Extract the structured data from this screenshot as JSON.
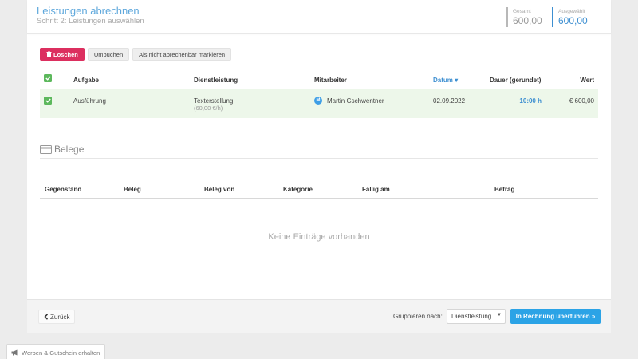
{
  "header": {
    "title": "Leistungen abrechnen",
    "subtitle": "Schritt 2: Leistungen auswählen",
    "total_label": "Gesamt",
    "total_value": "600,00",
    "selected_label": "Ausgewählt",
    "selected_value": "600,00"
  },
  "toolbar": {
    "delete_label": "Löschen",
    "rebook_label": "Umbuchen",
    "mark_label": "Als nicht abrechenbar markieren"
  },
  "services_table": {
    "columns": {
      "task": "Aufgabe",
      "service": "Dienstleistung",
      "employee": "Mitarbeiter",
      "date": "Datum",
      "duration": "Dauer (gerundet)",
      "value": "Wert"
    },
    "rows": [
      {
        "task": "Ausführung",
        "service": "Texterstellung",
        "rate": "(60,00 €/h)",
        "employee_initial": "M",
        "employee": "Martin Gschwentner",
        "date": "02.09.2022",
        "duration": "10:00 h",
        "value": "€ 600,00"
      }
    ]
  },
  "receipts": {
    "title": "Belege",
    "columns": {
      "subject": "Gegenstand",
      "receipt": "Beleg",
      "receipt_from": "Beleg von",
      "category": "Kategorie",
      "due": "Fällig am",
      "amount": "Betrag"
    },
    "empty_text": "Keine Einträge vorhanden"
  },
  "footer": {
    "back_label": "Zurück",
    "group_label": "Gruppieren nach:",
    "group_value": "Dienstleistung",
    "submit_label": "In Rechnung überführen »"
  },
  "promo": {
    "label": "Werben & Gutschein erhalten"
  },
  "colors": {
    "accent": "#3d8fd1",
    "danger": "#dc2f5f",
    "success": "#5cb85c",
    "primary_button": "#2ba3e6"
  }
}
